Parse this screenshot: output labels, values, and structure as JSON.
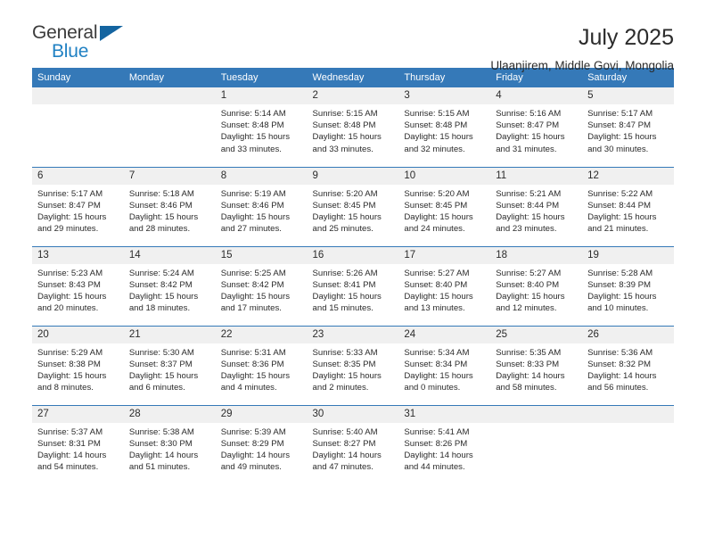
{
  "logo": {
    "word_top": "General",
    "word_bottom": "Blue",
    "accent_color": "#2081c3",
    "triangle_color": "#1464a0"
  },
  "header": {
    "title": "July 2025",
    "subtitle": "Ulaanjirem, Middle Govi, Mongolia"
  },
  "theme": {
    "header_blue": "#3579b8",
    "daynum_band": "#f0f0f0",
    "text": "#2b2b2b"
  },
  "calendar": {
    "weekday_headers": [
      "Sunday",
      "Monday",
      "Tuesday",
      "Wednesday",
      "Thursday",
      "Friday",
      "Saturday"
    ],
    "weeks": [
      [
        {
          "day": "",
          "detail": ""
        },
        {
          "day": "",
          "detail": ""
        },
        {
          "day": "1",
          "detail": "Sunrise: 5:14 AM\nSunset: 8:48 PM\nDaylight: 15 hours\nand 33 minutes."
        },
        {
          "day": "2",
          "detail": "Sunrise: 5:15 AM\nSunset: 8:48 PM\nDaylight: 15 hours\nand 33 minutes."
        },
        {
          "day": "3",
          "detail": "Sunrise: 5:15 AM\nSunset: 8:48 PM\nDaylight: 15 hours\nand 32 minutes."
        },
        {
          "day": "4",
          "detail": "Sunrise: 5:16 AM\nSunset: 8:47 PM\nDaylight: 15 hours\nand 31 minutes."
        },
        {
          "day": "5",
          "detail": "Sunrise: 5:17 AM\nSunset: 8:47 PM\nDaylight: 15 hours\nand 30 minutes."
        }
      ],
      [
        {
          "day": "6",
          "detail": "Sunrise: 5:17 AM\nSunset: 8:47 PM\nDaylight: 15 hours\nand 29 minutes."
        },
        {
          "day": "7",
          "detail": "Sunrise: 5:18 AM\nSunset: 8:46 PM\nDaylight: 15 hours\nand 28 minutes."
        },
        {
          "day": "8",
          "detail": "Sunrise: 5:19 AM\nSunset: 8:46 PM\nDaylight: 15 hours\nand 27 minutes."
        },
        {
          "day": "9",
          "detail": "Sunrise: 5:20 AM\nSunset: 8:45 PM\nDaylight: 15 hours\nand 25 minutes."
        },
        {
          "day": "10",
          "detail": "Sunrise: 5:20 AM\nSunset: 8:45 PM\nDaylight: 15 hours\nand 24 minutes."
        },
        {
          "day": "11",
          "detail": "Sunrise: 5:21 AM\nSunset: 8:44 PM\nDaylight: 15 hours\nand 23 minutes."
        },
        {
          "day": "12",
          "detail": "Sunrise: 5:22 AM\nSunset: 8:44 PM\nDaylight: 15 hours\nand 21 minutes."
        }
      ],
      [
        {
          "day": "13",
          "detail": "Sunrise: 5:23 AM\nSunset: 8:43 PM\nDaylight: 15 hours\nand 20 minutes."
        },
        {
          "day": "14",
          "detail": "Sunrise: 5:24 AM\nSunset: 8:42 PM\nDaylight: 15 hours\nand 18 minutes."
        },
        {
          "day": "15",
          "detail": "Sunrise: 5:25 AM\nSunset: 8:42 PM\nDaylight: 15 hours\nand 17 minutes."
        },
        {
          "day": "16",
          "detail": "Sunrise: 5:26 AM\nSunset: 8:41 PM\nDaylight: 15 hours\nand 15 minutes."
        },
        {
          "day": "17",
          "detail": "Sunrise: 5:27 AM\nSunset: 8:40 PM\nDaylight: 15 hours\nand 13 minutes."
        },
        {
          "day": "18",
          "detail": "Sunrise: 5:27 AM\nSunset: 8:40 PM\nDaylight: 15 hours\nand 12 minutes."
        },
        {
          "day": "19",
          "detail": "Sunrise: 5:28 AM\nSunset: 8:39 PM\nDaylight: 15 hours\nand 10 minutes."
        }
      ],
      [
        {
          "day": "20",
          "detail": "Sunrise: 5:29 AM\nSunset: 8:38 PM\nDaylight: 15 hours\nand 8 minutes."
        },
        {
          "day": "21",
          "detail": "Sunrise: 5:30 AM\nSunset: 8:37 PM\nDaylight: 15 hours\nand 6 minutes."
        },
        {
          "day": "22",
          "detail": "Sunrise: 5:31 AM\nSunset: 8:36 PM\nDaylight: 15 hours\nand 4 minutes."
        },
        {
          "day": "23",
          "detail": "Sunrise: 5:33 AM\nSunset: 8:35 PM\nDaylight: 15 hours\nand 2 minutes."
        },
        {
          "day": "24",
          "detail": "Sunrise: 5:34 AM\nSunset: 8:34 PM\nDaylight: 15 hours\nand 0 minutes."
        },
        {
          "day": "25",
          "detail": "Sunrise: 5:35 AM\nSunset: 8:33 PM\nDaylight: 14 hours\nand 58 minutes."
        },
        {
          "day": "26",
          "detail": "Sunrise: 5:36 AM\nSunset: 8:32 PM\nDaylight: 14 hours\nand 56 minutes."
        }
      ],
      [
        {
          "day": "27",
          "detail": "Sunrise: 5:37 AM\nSunset: 8:31 PM\nDaylight: 14 hours\nand 54 minutes."
        },
        {
          "day": "28",
          "detail": "Sunrise: 5:38 AM\nSunset: 8:30 PM\nDaylight: 14 hours\nand 51 minutes."
        },
        {
          "day": "29",
          "detail": "Sunrise: 5:39 AM\nSunset: 8:29 PM\nDaylight: 14 hours\nand 49 minutes."
        },
        {
          "day": "30",
          "detail": "Sunrise: 5:40 AM\nSunset: 8:27 PM\nDaylight: 14 hours\nand 47 minutes."
        },
        {
          "day": "31",
          "detail": "Sunrise: 5:41 AM\nSunset: 8:26 PM\nDaylight: 14 hours\nand 44 minutes."
        },
        {
          "day": "",
          "detail": ""
        },
        {
          "day": "",
          "detail": ""
        }
      ]
    ]
  }
}
